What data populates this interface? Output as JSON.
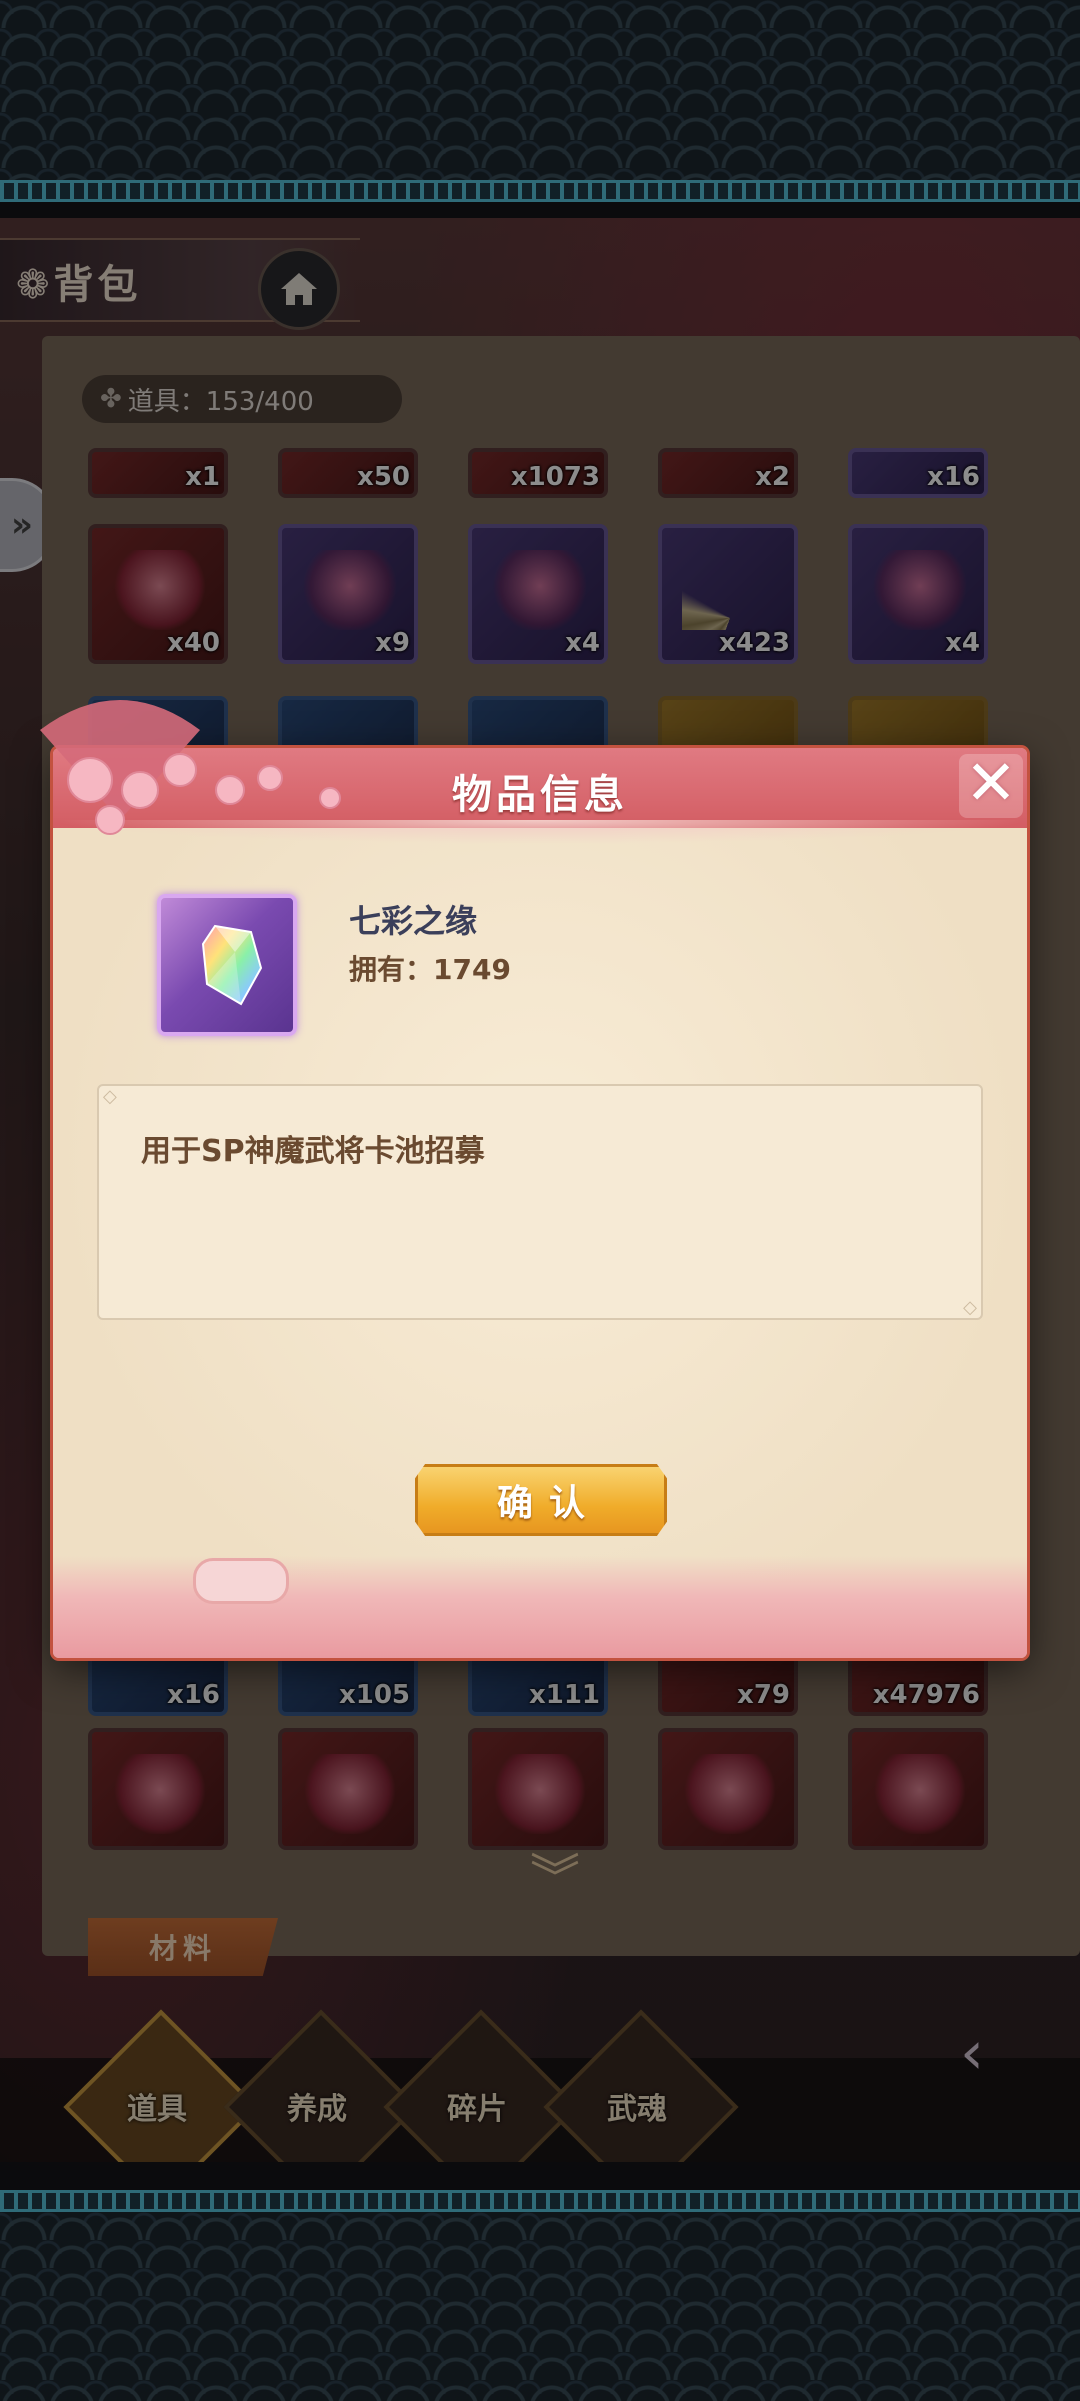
{
  "header": {
    "title": "背包",
    "home_icon": "home-icon"
  },
  "inventory": {
    "count_label": "道具：153/400",
    "row_partial": [
      "x1",
      "x50",
      "x1073",
      "x2",
      "x16"
    ],
    "row1": [
      "x40",
      "x9",
      "x4",
      "x423",
      "x4"
    ],
    "row_bottom": [
      "x16",
      "x105",
      "x111",
      "x79",
      "x47976"
    ]
  },
  "category_tab": "材料",
  "bottom_nav": {
    "items": [
      "道具",
      "养成",
      "碎片",
      "武魂"
    ],
    "active": "道具"
  },
  "modal": {
    "title": "物品信息",
    "item_name": "七彩之缘",
    "own_label": "拥有：1749",
    "description": "用于SP神魔武将卡池招募",
    "confirm_label": "确认"
  },
  "colors": {
    "modal_header": "#d35d63",
    "modal_body": "#efdfc4",
    "confirm_button": "#f0ac2a",
    "text_brown": "#6a4a30"
  }
}
